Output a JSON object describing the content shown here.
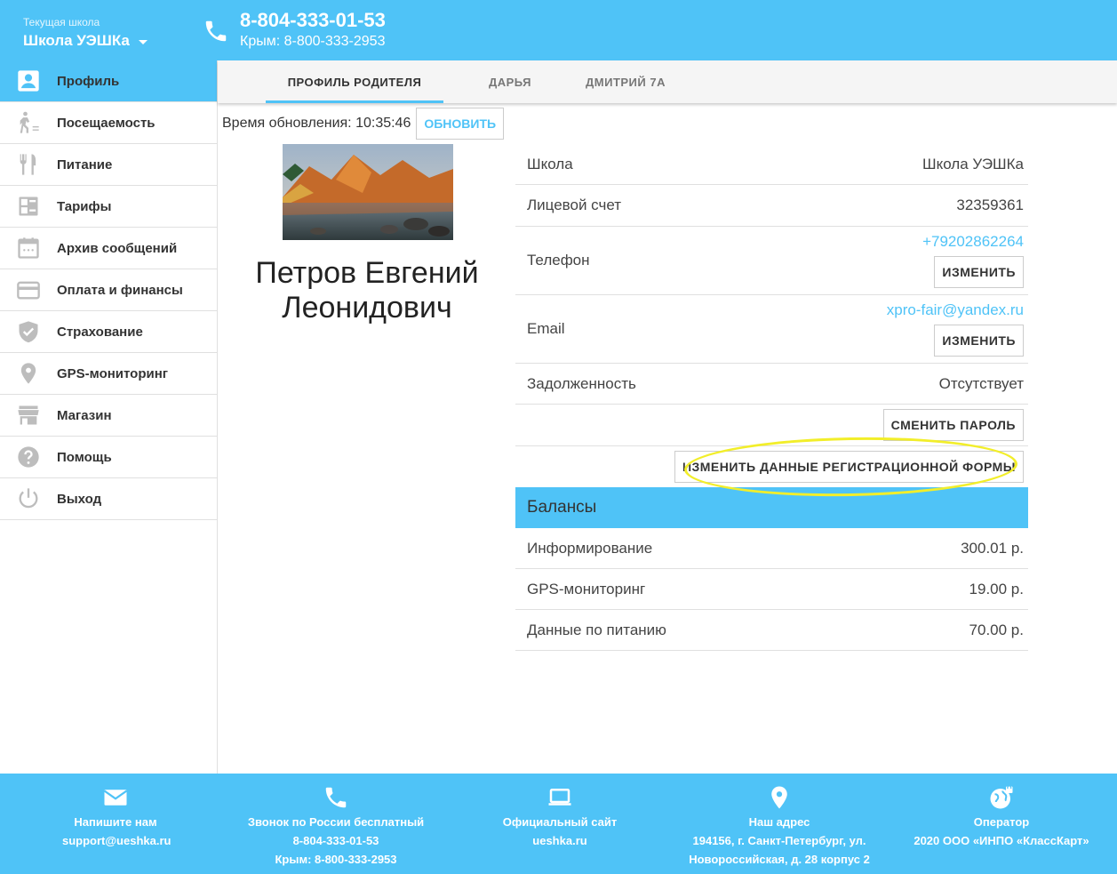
{
  "header": {
    "school_caption": "Текущая школа",
    "school_name": "Школа УЭШКа",
    "phone_main": "8-804-333-01-53",
    "phone_crimea": "Крым: 8-800-333-2953"
  },
  "sidebar": {
    "items": [
      {
        "label": "Профиль",
        "icon": "profile-icon",
        "active": true
      },
      {
        "label": "Посещаемость",
        "icon": "walker-icon"
      },
      {
        "label": "Питание",
        "icon": "fork-knife-icon"
      },
      {
        "label": "Тарифы",
        "icon": "tariff-grid-icon"
      },
      {
        "label": "Архив сообщений",
        "icon": "calendar-icon"
      },
      {
        "label": "Оплата и финансы",
        "icon": "credit-card-icon"
      },
      {
        "label": "Страхование",
        "icon": "shield-icon"
      },
      {
        "label": "GPS-мониторинг",
        "icon": "location-pin-icon"
      },
      {
        "label": "Магазин",
        "icon": "store-icon"
      },
      {
        "label": "Помощь",
        "icon": "help-icon"
      },
      {
        "label": "Выход",
        "icon": "power-icon"
      }
    ]
  },
  "tabs": [
    {
      "label": "ПРОФИЛЬ РОДИТЕЛЯ",
      "active": true
    },
    {
      "label": "ДАРЬЯ"
    },
    {
      "label": "ДМИТРИЙ 7А"
    }
  ],
  "main": {
    "update_time": "Время обновления: 10:35:46",
    "refresh_label": "ОБНОВИТЬ",
    "person_name": "Петров Евгений Леонидович",
    "info": {
      "school_label": "Школа",
      "school_value": "Школа УЭШКа",
      "account_label": "Лицевой счет",
      "account_value": "32359361",
      "phone_label": "Телефон",
      "phone_value": "+79202862264",
      "change_label": "ИЗМЕНИТЬ",
      "email_label": "Email",
      "email_value": "xpro-fair@yandex.ru",
      "debt_label": "Задолженность",
      "debt_value": "Отсутствует",
      "change_password_label": "СМЕНИТЬ ПАРОЛЬ",
      "change_registration_label": "ИЗМЕНИТЬ ДАННЫЕ РЕГИСТРАЦИОННОЙ ФОРМЫ"
    },
    "balances": {
      "title": "Балансы",
      "items": [
        {
          "label": "Информирование",
          "value": "300.01 р."
        },
        {
          "label": "GPS-мониторинг",
          "value": "19.00 р."
        },
        {
          "label": "Данные по питанию",
          "value": "70.00 р."
        }
      ]
    }
  },
  "footer": {
    "write": {
      "title": "Напишите нам",
      "line1": "support@ueshka.ru"
    },
    "call": {
      "title": "Звонок по России бесплатный",
      "line1": "8-804-333-01-53",
      "line2": "Крым: 8-800-333-2953"
    },
    "site": {
      "title": "Официальный сайт",
      "line1": "ueshka.ru"
    },
    "address": {
      "title": "Наш адрес",
      "line1": "194156, г. Санкт-Петербург, ул.",
      "line2": "Новороссийская, д. 28 корпус 2"
    },
    "operator": {
      "title": "Оператор",
      "line1": "2020 ООО «ИНПО «КлассКарт»"
    }
  },
  "colors": {
    "accent": "#4fc3f7",
    "highlight": "#f2ee2a"
  }
}
